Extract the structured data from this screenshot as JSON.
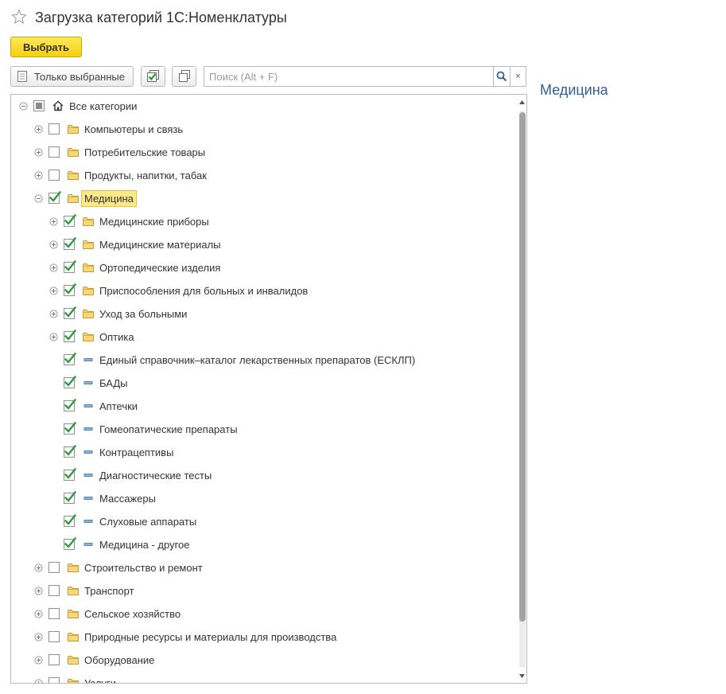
{
  "window": {
    "title": "Загрузка категорий 1С:Номенклатуры"
  },
  "toolbar": {
    "select_label": "Выбрать",
    "only_selected_label": "Только выбранные",
    "search_placeholder": "Поиск (Alt + F)",
    "clear_label": "×"
  },
  "side_panel": {
    "title": "Медицина"
  },
  "tree": {
    "nodes": [
      {
        "label": "Все категории",
        "level": 0,
        "expander": "minus",
        "check": "partial",
        "icon": "home-icon"
      },
      {
        "label": "Компьютеры и связь",
        "level": 1,
        "expander": "plus",
        "check": "unchecked",
        "icon": "folder-icon"
      },
      {
        "label": "Потребительские товары",
        "level": 1,
        "expander": "plus",
        "check": "unchecked",
        "icon": "folder-icon"
      },
      {
        "label": "Продукты, напитки, табак",
        "level": 1,
        "expander": "plus",
        "check": "unchecked",
        "icon": "folder-icon"
      },
      {
        "label": "Медицина",
        "level": 1,
        "expander": "minus",
        "check": "checked",
        "icon": "folder-icon",
        "selected": true
      },
      {
        "label": "Медицинские приборы",
        "level": 2,
        "expander": "plus",
        "check": "checked",
        "icon": "folder-icon"
      },
      {
        "label": "Медицинские материалы",
        "level": 2,
        "expander": "plus",
        "check": "checked",
        "icon": "folder-icon"
      },
      {
        "label": "Ортопедические изделия",
        "level": 2,
        "expander": "plus",
        "check": "checked",
        "icon": "folder-icon"
      },
      {
        "label": "Приспособления для больных и инвалидов",
        "level": 2,
        "expander": "plus",
        "check": "checked",
        "icon": "folder-icon"
      },
      {
        "label": "Уход за больными",
        "level": 2,
        "expander": "plus",
        "check": "checked",
        "icon": "folder-icon"
      },
      {
        "label": "Оптика",
        "level": 2,
        "expander": "plus",
        "check": "checked",
        "icon": "folder-icon"
      },
      {
        "label": "Единый справочник–каталог лекарственных препаратов (ЕСКЛП)",
        "level": 2,
        "expander": "none",
        "check": "checked",
        "icon": "element-icon"
      },
      {
        "label": "БАДы",
        "level": 2,
        "expander": "none",
        "check": "checked",
        "icon": "element-icon"
      },
      {
        "label": "Аптечки",
        "level": 2,
        "expander": "none",
        "check": "checked",
        "icon": "element-icon"
      },
      {
        "label": "Гомеопатические препараты",
        "level": 2,
        "expander": "none",
        "check": "checked",
        "icon": "element-icon"
      },
      {
        "label": "Контрацептивы",
        "level": 2,
        "expander": "none",
        "check": "checked",
        "icon": "element-icon"
      },
      {
        "label": "Диагностические тесты",
        "level": 2,
        "expander": "none",
        "check": "checked",
        "icon": "element-icon"
      },
      {
        "label": "Массажеры",
        "level": 2,
        "expander": "none",
        "check": "checked",
        "icon": "element-icon"
      },
      {
        "label": "Слуховые аппараты",
        "level": 2,
        "expander": "none",
        "check": "checked",
        "icon": "element-icon"
      },
      {
        "label": "Медицина - другое",
        "level": 2,
        "expander": "none",
        "check": "checked",
        "icon": "element-icon"
      },
      {
        "label": "Строительство и ремонт",
        "level": 1,
        "expander": "plus",
        "check": "unchecked",
        "icon": "folder-icon"
      },
      {
        "label": "Транспорт",
        "level": 1,
        "expander": "plus",
        "check": "unchecked",
        "icon": "folder-icon"
      },
      {
        "label": "Сельское хозяйство",
        "level": 1,
        "expander": "plus",
        "check": "unchecked",
        "icon": "folder-icon"
      },
      {
        "label": "Природные ресурсы и материалы для производства",
        "level": 1,
        "expander": "plus",
        "check": "unchecked",
        "icon": "folder-icon"
      },
      {
        "label": "Оборудование",
        "level": 1,
        "expander": "plus",
        "check": "unchecked",
        "icon": "folder-icon"
      },
      {
        "label": "Услуги",
        "level": 1,
        "expander": "plus",
        "check": "unchecked",
        "icon": "folder-icon"
      }
    ]
  },
  "colors": {
    "accent_yellow": "#f5cf0f",
    "check_green": "#2a9b3c",
    "side_title_blue": "#2f5f96",
    "folder_fill": "#f6d77c",
    "selection_fill": "#fbe98a"
  }
}
